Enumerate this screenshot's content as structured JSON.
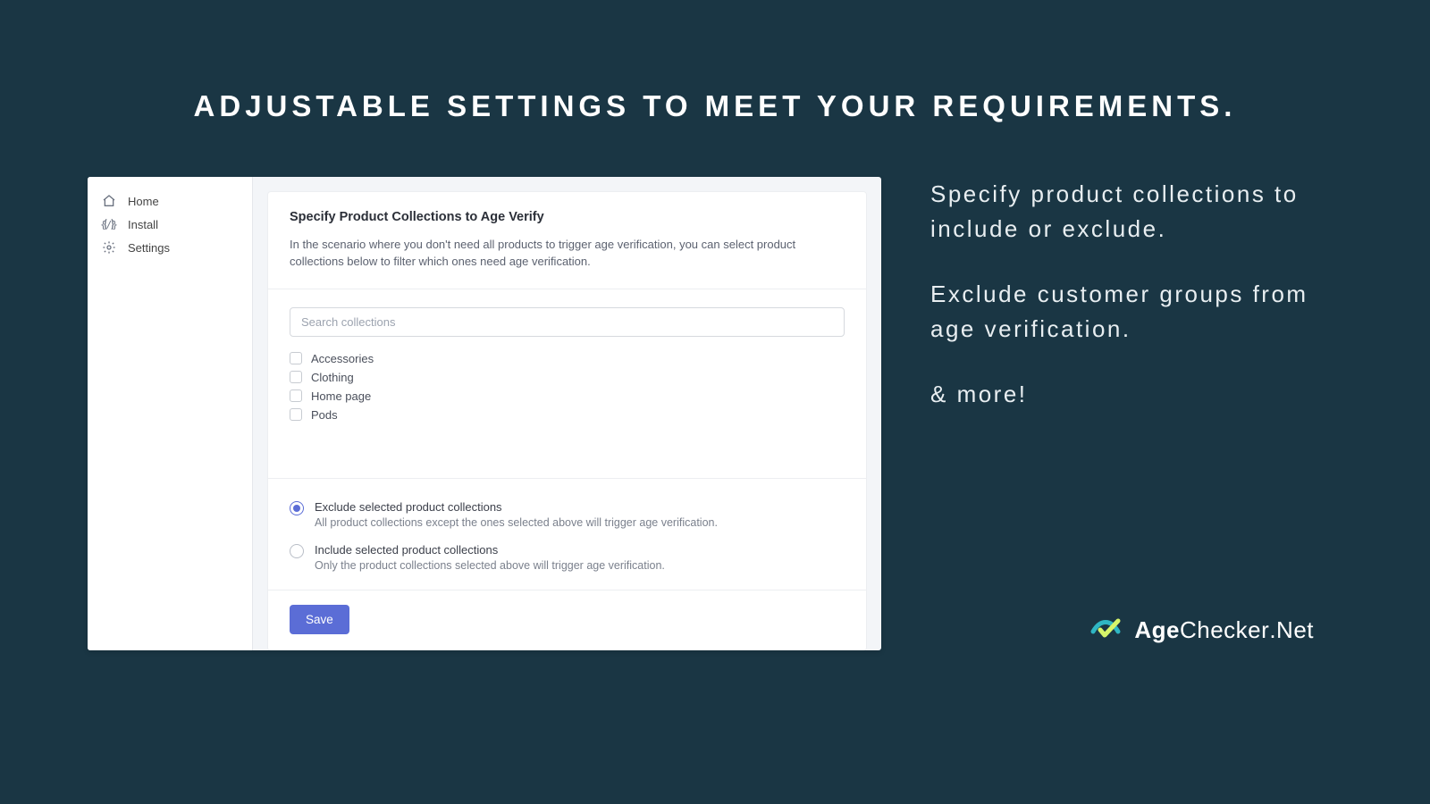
{
  "hero": {
    "title": "ADJUSTABLE SETTINGS TO MEET YOUR REQUIREMENTS."
  },
  "sidebar": {
    "items": [
      {
        "label": "Home"
      },
      {
        "label": "Install"
      },
      {
        "label": "Settings"
      }
    ]
  },
  "card": {
    "title": "Specify Product Collections to Age Verify",
    "description": "In the scenario where you don't need all products to trigger age verification, you can select product collections below to filter which ones need age verification.",
    "search_placeholder": "Search collections",
    "collections": [
      {
        "label": "Accessories"
      },
      {
        "label": "Clothing"
      },
      {
        "label": "Home page"
      },
      {
        "label": "Pods"
      }
    ],
    "radios": [
      {
        "label": "Exclude selected product collections",
        "sub": "All product collections except the ones selected above will trigger age verification.",
        "selected": true
      },
      {
        "label": "Include selected product collections",
        "sub": "Only the product collections selected above will trigger age verification.",
        "selected": false
      }
    ],
    "save_label": "Save"
  },
  "promo": {
    "p1": "Specify product collections to include or exclude.",
    "p2": "Exclude customer groups from age verification.",
    "p3": "& more!"
  },
  "brand": {
    "t1": "Age",
    "t2": "Checker",
    "t3": ".Net"
  }
}
